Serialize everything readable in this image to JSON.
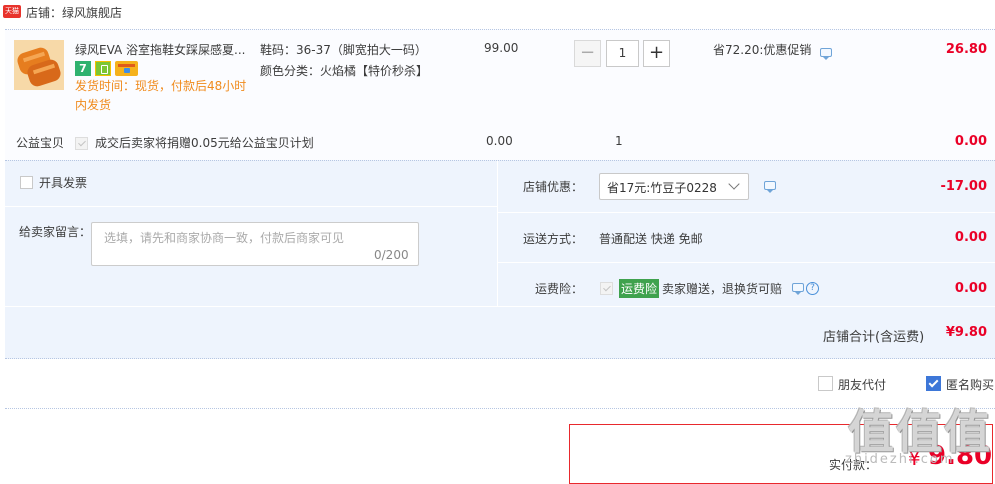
{
  "shop": {
    "badge": "天猫",
    "name": "店铺：绿风旗舰店"
  },
  "item": {
    "title": "绿风EVA 浴室拖鞋女踩屎感夏季防滑",
    "title_display": "绿风EVA 浴室拖鞋女踩屎感夏...",
    "badge_7": "7",
    "ship_time": "发货时间：现货，付款后48小时内发货",
    "sku_size": "鞋码：36-37（脚宽拍大一码）",
    "sku_color": "颜色分类：火焰橘【特价秒杀】",
    "price": "99.00",
    "qty_minus": "−",
    "quantity": "1",
    "qty_plus": "+",
    "promo": "省72.20:优惠促销",
    "total": "26.80"
  },
  "charity": {
    "label": "公益宝贝",
    "desc": "成交后卖家将捐赠0.05元给公益宝贝计划",
    "price": "0.00",
    "qty": "1",
    "total": "0.00"
  },
  "invoice": {
    "label": "开具发票"
  },
  "message": {
    "label": "给卖家留言：",
    "placeholder": "选填，请先和商家协商一致，付款后商家可见",
    "counter": "0/200"
  },
  "coupon": {
    "label": "店铺优惠：",
    "selected": "省17元:竹豆子0228",
    "amount": "-17.00"
  },
  "shipping": {
    "label": "运送方式：",
    "value": "普通配送 快递 免邮",
    "amount": "0.00"
  },
  "insurance": {
    "label": "运费险：",
    "tag": "运费险",
    "desc": "卖家赠送，退换货可赔",
    "help": "?",
    "amount": "0.00"
  },
  "shop_total": {
    "label": "店铺合计(含运费)",
    "amount": "¥9.80"
  },
  "options": {
    "friend_pay": "朋友代付",
    "anonymous": "匿名购买"
  },
  "payment": {
    "label": "实付款：",
    "symbol": "¥",
    "amount": "9.80"
  },
  "watermark": {
    "text": "值值值",
    "url": "zhidezhi.com"
  },
  "colors": {
    "accent_red": "#ea0027",
    "panel_blue": "#eef4fd",
    "ship_orange": "#f08b1d",
    "insurance_green": "#3fa24e",
    "checkbox_blue": "#3d77d8"
  }
}
